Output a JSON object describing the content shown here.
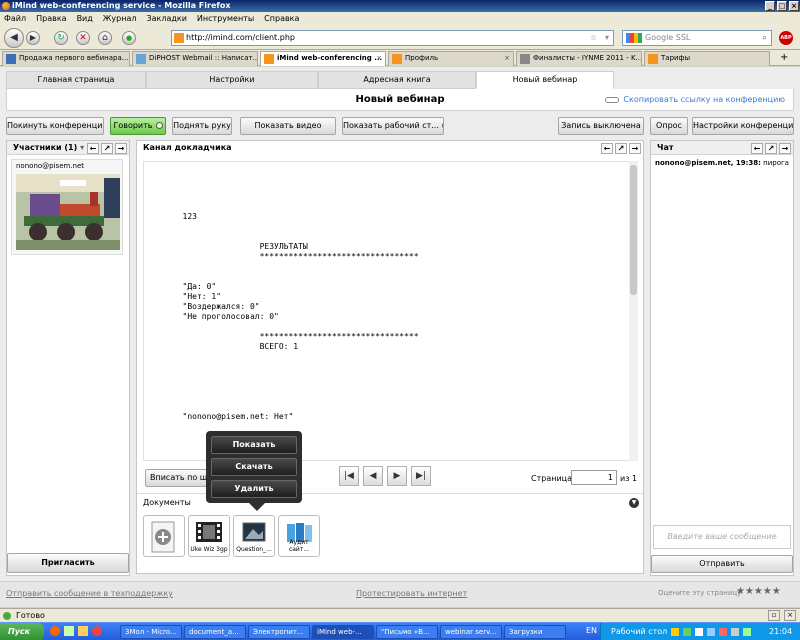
{
  "window": {
    "title": "iMind web-conferencing service - Mozilla Firefox"
  },
  "menu": [
    "Файл",
    "Правка",
    "Вид",
    "Журнал",
    "Закладки",
    "Инструменты",
    "Справка"
  ],
  "nav": {
    "url": "http://imind.com/client.php",
    "search_placeholder": "Google SSL",
    "abp": "ABP"
  },
  "browser_tabs": [
    {
      "label": "Продажа первого вебинара..."
    },
    {
      "label": "DiPHOST Webmail :: Написат..."
    },
    {
      "label": "iMind web-conferencing ..."
    },
    {
      "label": "Профиль"
    },
    {
      "label": "Финалисты - IYNME 2011 - K..."
    },
    {
      "label": "Тарифы"
    }
  ],
  "app_tabs": [
    "Главная страница",
    "Настройки",
    "Адресная книга",
    "Новый вебинар"
  ],
  "heading": {
    "title": "Новый вебинар",
    "copy_link": "Скопировать ссылку на конференцию"
  },
  "toolbar": {
    "leave": "Покинуть конференцию",
    "talk": "Говорить",
    "raise_hand": "Поднять руку",
    "show_video": "Показать видео",
    "show_desktop": "Показать рабочий ст...",
    "recording": "Запись выключена",
    "poll": "Опрос",
    "settings": "Настройки конференции"
  },
  "participants": {
    "title": "Участники (1)",
    "user": "nonono@pisem.net",
    "invite": "Пригласить"
  },
  "speaker": {
    "title": "Канал докладчика",
    "doc_lines": [
      "",
      "",
      "",
      "",
      "",
      "        123",
      "",
      "",
      "                        РЕЗУЛЬТАТЫ",
      "                        *********************************",
      "",
      "",
      "        \"Да: 0\"",
      "        \"Нет: 1\"",
      "        \"Воздержался: 0\"",
      "        \"Не проголосовал: 0\"",
      "",
      "                        *********************************",
      "                        ВСЕГО: 1",
      "",
      "",
      "",
      "",
      "",
      "",
      "        \"nonono@pisem.net: Нет\""
    ],
    "fit_label": "Вписать по ширине",
    "page_label": "Страница",
    "page_value": "1",
    "page_of": "из",
    "page_total": "1"
  },
  "popup": {
    "items": [
      "Показать",
      "Скачать",
      "Удалить"
    ]
  },
  "documents": {
    "title": "Документы",
    "items": [
      {
        "caption": "",
        "icon": "add-icon"
      },
      {
        "caption": "Uke Wiz 3gp",
        "icon": "film-icon"
      },
      {
        "caption": "Question_...",
        "icon": "image-icon"
      },
      {
        "caption": "Аудит сайт...",
        "icon": "book-icon"
      }
    ]
  },
  "chat": {
    "title": "Чат",
    "message_user": "nonono@pisem.net, 19:38:",
    "message_text": " пирога",
    "input_placeholder": "Введите ваше сообщение",
    "send": "Отправить"
  },
  "footer": {
    "support": "Отправить сообщение в техподдержку",
    "test": "Протестировать интернет",
    "rate": "Оцените эту страницу",
    "stars": "★★★★★"
  },
  "status": {
    "text": "Готово"
  },
  "taskbar": {
    "start": "Пуск",
    "items": [
      "3Mол - Micro...",
      "document_a...",
      "Электропит...",
      "iMind web-...",
      "\"Письмо «В...",
      "webinar serv...",
      "Загрузки"
    ],
    "lang": "EN",
    "desktop": "Рабочий стол",
    "clock": "21:04"
  }
}
